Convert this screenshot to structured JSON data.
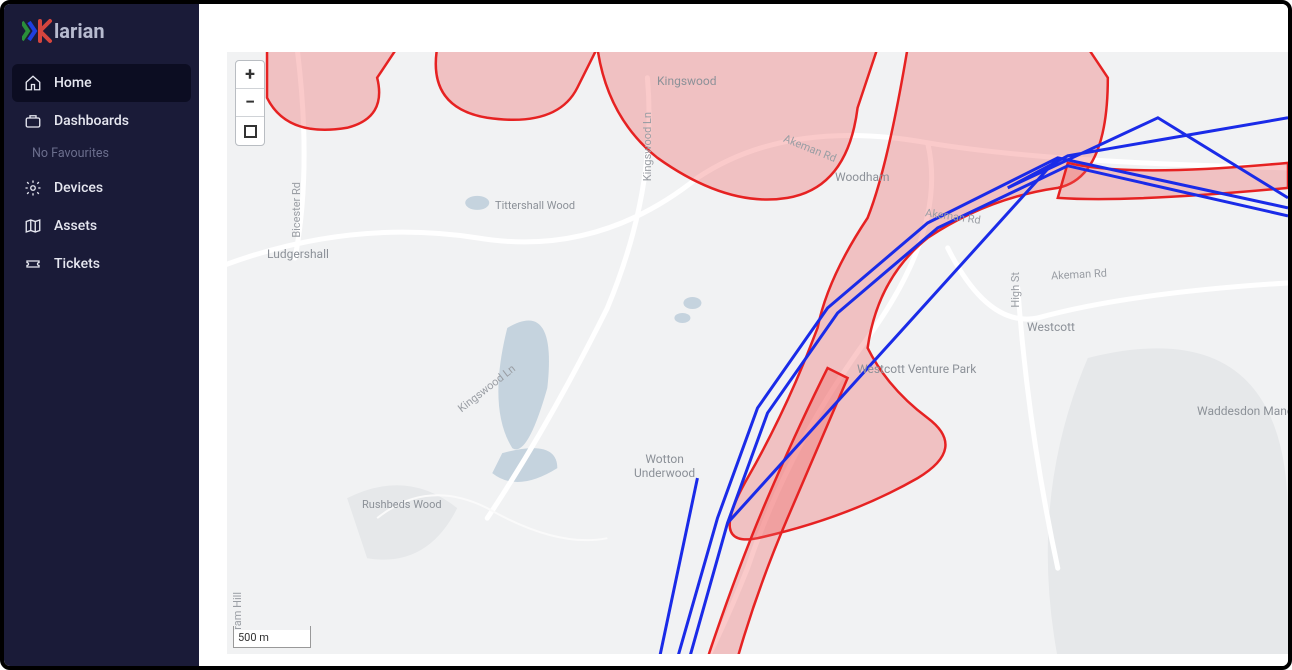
{
  "brand": {
    "name": "Klarian"
  },
  "sidebar": {
    "items": [
      {
        "label": "Home",
        "icon": "home-icon",
        "active": true
      },
      {
        "label": "Dashboards",
        "icon": "briefcase-icon",
        "active": false
      },
      {
        "label": "Devices",
        "icon": "gear-icon",
        "active": false
      },
      {
        "label": "Assets",
        "icon": "map-icon",
        "active": false
      },
      {
        "label": "Tickets",
        "icon": "ticket-icon",
        "active": false
      }
    ],
    "favourites_label": "No Favourites"
  },
  "map_controls": {
    "zoom_in": "+",
    "zoom_out": "−",
    "reset": "□"
  },
  "scale_label": "500 m",
  "map_labels": {
    "kingswood": "Kingswood",
    "woodham": "Woodham",
    "ludgershall": "Ludgershall",
    "tittershall_wood": "Tittershall Wood",
    "westcott_venture_park": "Westcott Venture Park",
    "westcott": "Westcott",
    "waddesdon_manor": "Waddesdon Manor",
    "wotton_underwood": "Wotton\nUnderwood",
    "rushbeds_wood": "Rushbeds Wood",
    "kingswood_ln1": "Kingswood Ln",
    "kingswood_ln2": "Kingswood Ln",
    "akeman_rd1": "Akeman Rd",
    "akeman_rd2": "Akeman Rd",
    "akeman_rd3": "Akeman Rd",
    "bicester_rd": "Bicester Rd",
    "high_st": "High St",
    "gram_hill": "ram Hill"
  }
}
